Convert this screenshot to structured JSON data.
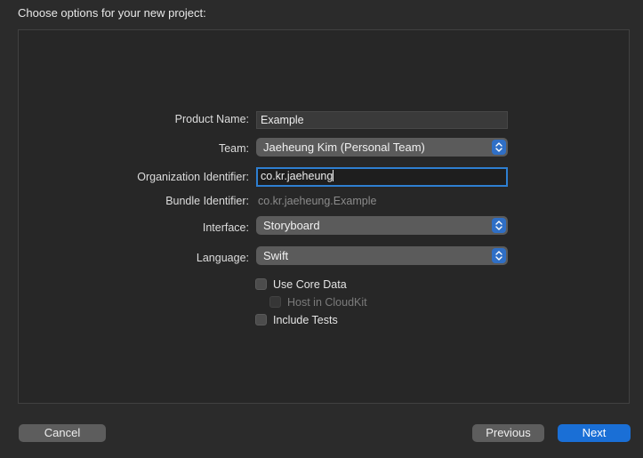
{
  "sheet": {
    "title": "Choose options for your new project:"
  },
  "form": {
    "product_name": {
      "label": "Product Name:",
      "value": "Example"
    },
    "team": {
      "label": "Team:",
      "value": "Jaeheung Kim (Personal Team)"
    },
    "organization_identifier": {
      "label": "Organization Identifier:",
      "value": "co.kr.jaeheung"
    },
    "bundle_identifier": {
      "label": "Bundle Identifier:",
      "value": "co.kr.jaeheung.Example"
    },
    "interface": {
      "label": "Interface:",
      "value": "Storyboard"
    },
    "language": {
      "label": "Language:",
      "value": "Swift"
    },
    "use_core_data": {
      "label": "Use Core Data",
      "checked": false
    },
    "host_in_cloudkit": {
      "label": "Host in CloudKit",
      "checked": false,
      "enabled": false
    },
    "include_tests": {
      "label": "Include Tests",
      "checked": false
    }
  },
  "buttons": {
    "cancel": "Cancel",
    "previous": "Previous",
    "next": "Next"
  },
  "colors": {
    "accent": "#1a6fd6",
    "focus_ring": "#2e7fd1"
  }
}
